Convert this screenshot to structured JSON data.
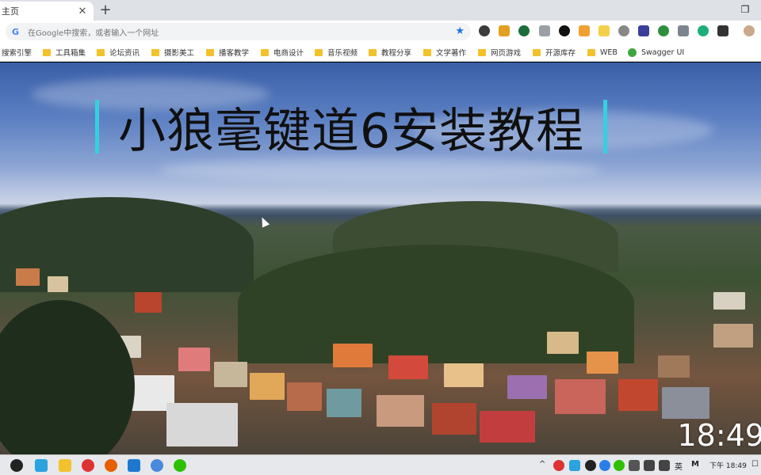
{
  "browser": {
    "tab": {
      "title": "主页"
    },
    "omnibox": {
      "placeholder": "在Google中搜索，或者输入一个网址"
    },
    "bookmarks": [
      {
        "label": "搜索引擎",
        "icon": "folder-icon"
      },
      {
        "label": "工具箱集",
        "icon": "folder-icon"
      },
      {
        "label": "论坛资讯",
        "icon": "folder-icon"
      },
      {
        "label": "摄影美工",
        "icon": "folder-icon"
      },
      {
        "label": "播客教学",
        "icon": "folder-icon"
      },
      {
        "label": "电商设计",
        "icon": "folder-icon"
      },
      {
        "label": "音乐视频",
        "icon": "folder-icon"
      },
      {
        "label": "教程分享",
        "icon": "folder-icon"
      },
      {
        "label": "文学著作",
        "icon": "folder-icon"
      },
      {
        "label": "网页游戏",
        "icon": "folder-icon"
      },
      {
        "label": "开源库存",
        "icon": "folder-icon"
      },
      {
        "label": "WEB",
        "icon": "folder-icon"
      },
      {
        "label": "Swagger UI",
        "icon": "swagger-icon"
      }
    ],
    "accent": "#1a73e8"
  },
  "page": {
    "headline": "小狼毫键道6安装教程",
    "clock_overlay": "18:49",
    "accent_bar_color": "#35d0e0"
  },
  "taskbar": {
    "ime_label": "英",
    "ime_mode": "M",
    "time": "下午 18:49"
  }
}
